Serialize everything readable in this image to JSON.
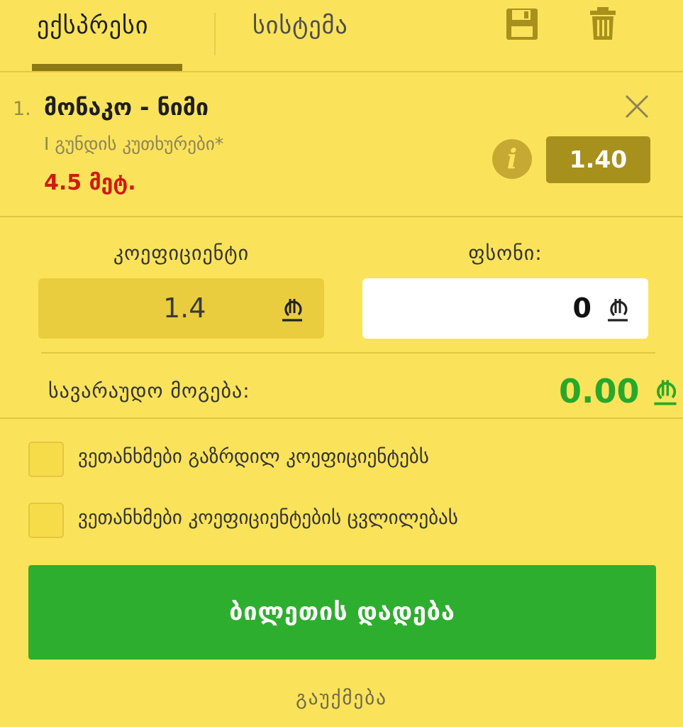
{
  "header": {
    "tabs": [
      {
        "label": "ექსპრესი",
        "active": true
      },
      {
        "label": "სისტემა",
        "active": false
      }
    ],
    "icons": {
      "save": "floppy-disk-icon",
      "delete": "trash-icon"
    }
  },
  "bet": {
    "index": "1.",
    "match": "მონაკო - ნიმი",
    "market": "I გუნდის კუთხურები*",
    "selection": "4.5 მეტ.",
    "odds": "1.40"
  },
  "coefficient": {
    "label": "კოეფიციენტი",
    "value": "1.4"
  },
  "stake": {
    "label": "ფსონი:",
    "value": "0"
  },
  "potential_win": {
    "label": "სავარაუდო მოგება:",
    "value": "0.00"
  },
  "checkboxes": [
    {
      "label": "ვეთანხმები გაზრდილ კოეფიციენტებს",
      "checked": false
    },
    {
      "label": "ვეთანხმები კოეფიციენტების ცვლილებას",
      "checked": false
    }
  ],
  "buttons": {
    "place_bet": "ბილეთის დადება",
    "cancel": "გაუქმება"
  },
  "colors": {
    "background": "#fae35a",
    "odds_badge": "#a7901c",
    "selection_red": "#d11a0f",
    "win_green": "#27a82c",
    "place_button": "#2eae2f"
  }
}
